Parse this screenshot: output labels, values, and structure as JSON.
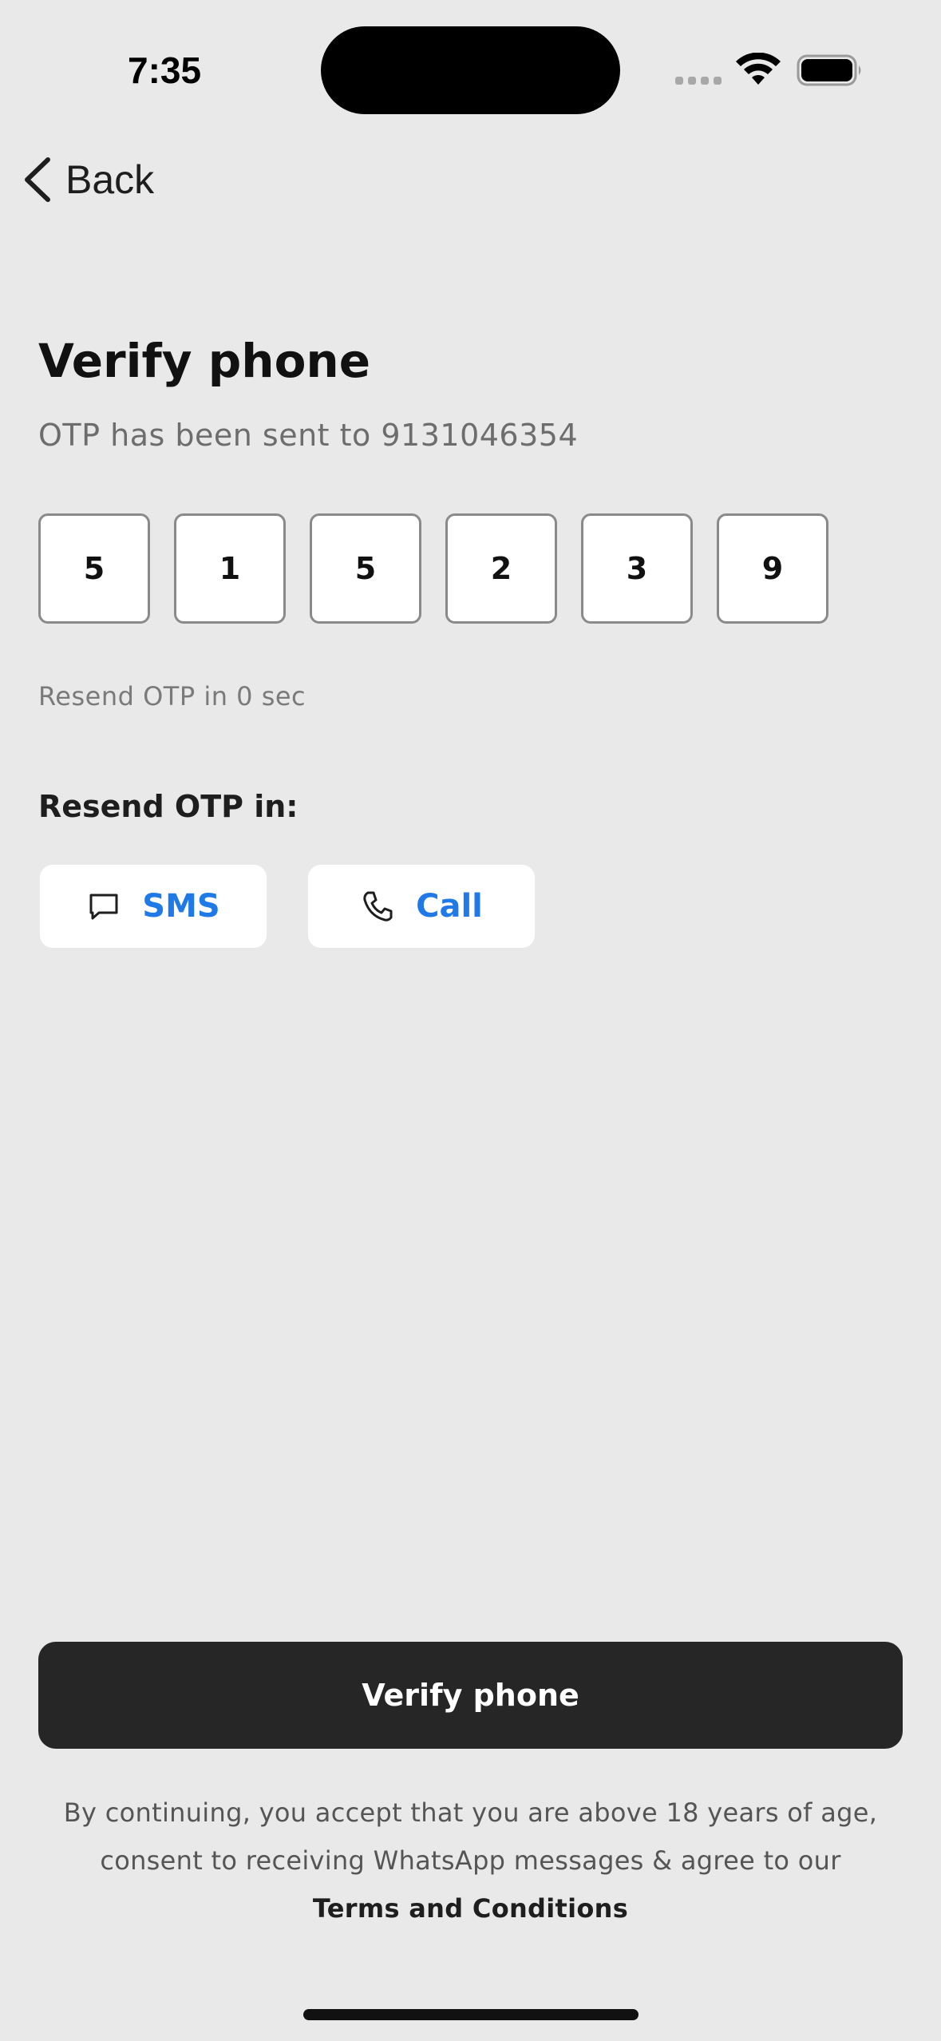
{
  "status_bar": {
    "time": "7:35"
  },
  "nav": {
    "back_label": "Back"
  },
  "header": {
    "title": "Verify phone",
    "subtitle": "OTP has been sent to 9131046354"
  },
  "otp": {
    "digits": [
      "5",
      "1",
      "5",
      "2",
      "3",
      "9"
    ]
  },
  "resend": {
    "timer_text": "Resend OTP in 0 sec",
    "label": "Resend OTP in:",
    "options": [
      {
        "label": "SMS",
        "icon": "message-icon"
      },
      {
        "label": "Call",
        "icon": "phone-icon"
      }
    ],
    "accent_color": "#1f7ae8"
  },
  "primary_action": {
    "label": "Verify phone"
  },
  "legal": {
    "line1": "By continuing, you accept that you are above 18 years of age,",
    "line2": "consent to receiving WhatsApp messages & agree to our",
    "terms_link": "Terms and Conditions"
  }
}
